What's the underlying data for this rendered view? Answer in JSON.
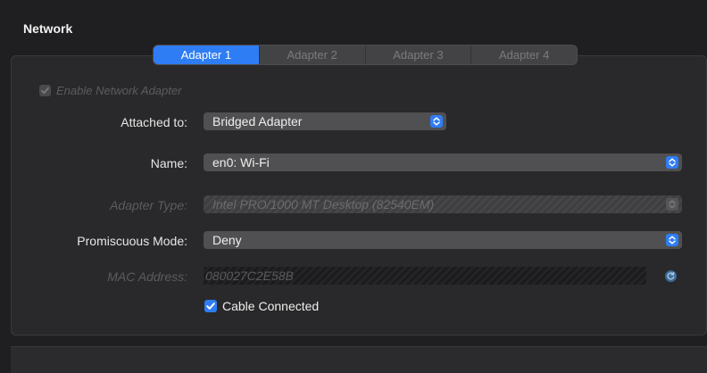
{
  "section": {
    "title": "Network"
  },
  "tabs": [
    {
      "label": "Adapter 1",
      "active": true
    },
    {
      "label": "Adapter 2",
      "active": false
    },
    {
      "label": "Adapter 3",
      "active": false
    },
    {
      "label": "Adapter 4",
      "active": false
    }
  ],
  "enable_adapter": {
    "label": "Enable Network Adapter",
    "checked": true,
    "disabled": true
  },
  "fields": {
    "attached_to": {
      "label": "Attached to:",
      "value": "Bridged Adapter"
    },
    "name": {
      "label": "Name:",
      "value": "en0: Wi-Fi"
    },
    "adapter_type": {
      "label": "Adapter Type:",
      "value": "Intel PRO/1000 MT Desktop (82540EM)"
    },
    "promiscuous_mode": {
      "label": "Promiscuous Mode:",
      "value": "Deny"
    },
    "mac_address": {
      "label": "MAC Address:",
      "value": "080027C2E58B"
    }
  },
  "cable_connected": {
    "label": "Cable Connected",
    "checked": true
  },
  "colors": {
    "accent": "#2f7df4",
    "panel": "#29292b",
    "background": "#1f1f21"
  }
}
